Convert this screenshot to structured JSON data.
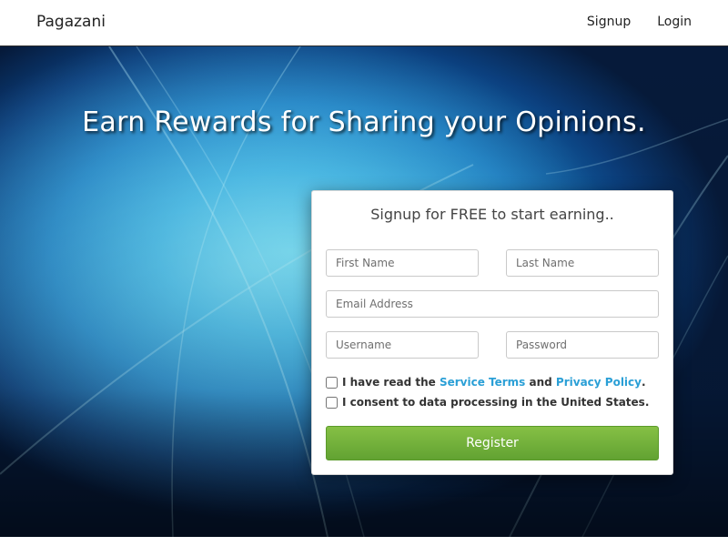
{
  "nav": {
    "brand": "Pagazani",
    "links": [
      "Signup",
      "Login"
    ]
  },
  "hero": {
    "headline": "Earn Rewards for Sharing your Opinions."
  },
  "form": {
    "title": "Signup for FREE to start earning..",
    "placeholders": {
      "first_name": "First Name",
      "last_name": "Last Name",
      "email": "Email Address",
      "username": "Username",
      "password": "Password"
    },
    "terms": {
      "prefix": "I have read the",
      "service_terms": "Service Terms",
      "and": "and",
      "privacy_policy": "Privacy Policy",
      "suffix": ".",
      "checked": false
    },
    "consent": {
      "text": "I consent to data processing in the United States.",
      "checked": false
    },
    "register_label": "Register"
  },
  "colors": {
    "link": "#2a9fd6",
    "button": "#6fae38",
    "hero_light": "#5fd3f2",
    "hero_dark": "#061a3a"
  }
}
